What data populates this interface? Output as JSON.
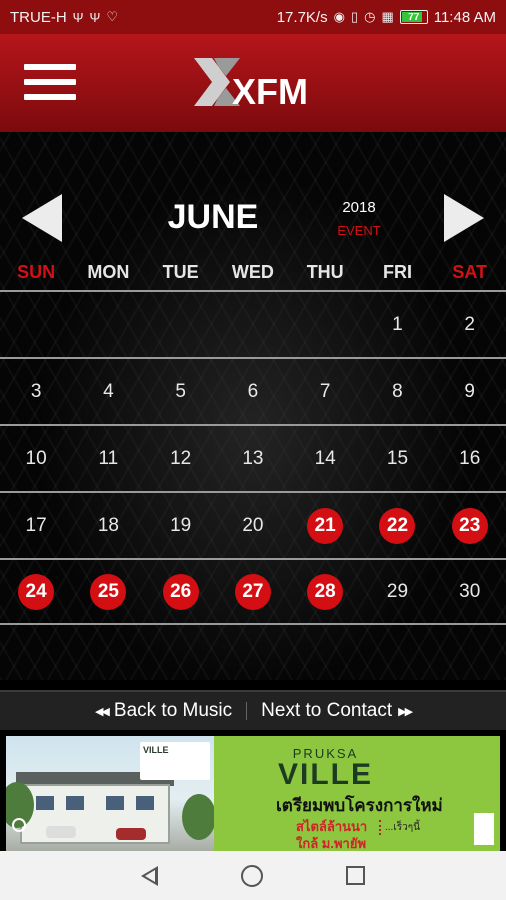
{
  "status_bar": {
    "carrier": "TRUE-H",
    "left_icons": [
      "usb-icon",
      "usb-icon",
      "heart-icon"
    ],
    "speed": "17.7K/s",
    "right_icons": [
      "hotspot-icon",
      "vibrate-icon",
      "alarm-icon",
      "signal-icon"
    ],
    "battery_level": "77",
    "time": "11:48 AM"
  },
  "header": {
    "logo_text": "XFM",
    "menu_icon": "hamburger-icon"
  },
  "calendar": {
    "month": "JUNE",
    "year": "2018",
    "event_label": "EVENT",
    "weekdays": [
      "SUN",
      "MON",
      "TUE",
      "WED",
      "THU",
      "FRI",
      "SAT"
    ],
    "accent_color": "#d40f14",
    "weeks": [
      [
        {
          "day": "",
          "event": false
        },
        {
          "day": "",
          "event": false
        },
        {
          "day": "",
          "event": false
        },
        {
          "day": "",
          "event": false
        },
        {
          "day": "",
          "event": false
        },
        {
          "day": "1",
          "event": false
        },
        {
          "day": "2",
          "event": false
        }
      ],
      [
        {
          "day": "3",
          "event": false
        },
        {
          "day": "4",
          "event": false
        },
        {
          "day": "5",
          "event": false
        },
        {
          "day": "6",
          "event": false
        },
        {
          "day": "7",
          "event": false
        },
        {
          "day": "8",
          "event": false
        },
        {
          "day": "9",
          "event": false
        }
      ],
      [
        {
          "day": "10",
          "event": false
        },
        {
          "day": "11",
          "event": false
        },
        {
          "day": "12",
          "event": false
        },
        {
          "day": "13",
          "event": false
        },
        {
          "day": "14",
          "event": false
        },
        {
          "day": "15",
          "event": false
        },
        {
          "day": "16",
          "event": false
        }
      ],
      [
        {
          "day": "17",
          "event": false
        },
        {
          "day": "18",
          "event": false
        },
        {
          "day": "19",
          "event": false
        },
        {
          "day": "20",
          "event": false
        },
        {
          "day": "21",
          "event": true
        },
        {
          "day": "22",
          "event": true
        },
        {
          "day": "23",
          "event": true
        }
      ],
      [
        {
          "day": "24",
          "event": true
        },
        {
          "day": "25",
          "event": true
        },
        {
          "day": "26",
          "event": true
        },
        {
          "day": "27",
          "event": true
        },
        {
          "day": "28",
          "event": true
        },
        {
          "day": "29",
          "event": false
        },
        {
          "day": "30",
          "event": false
        }
      ]
    ]
  },
  "bottom_nav": {
    "back_label": "Back to Music",
    "next_label": "Next to Contact"
  },
  "ad": {
    "brand_top": "PRUKSA",
    "brand_main": "VILLE",
    "headline": "เตรียมพบโครงการใหม่",
    "line_style": "สไตล์ล้านนา",
    "line_location": "ใกล้ ม.พายัพ",
    "line_soon": "...เร็วๆนี้",
    "mini_brand": "VILLE"
  }
}
